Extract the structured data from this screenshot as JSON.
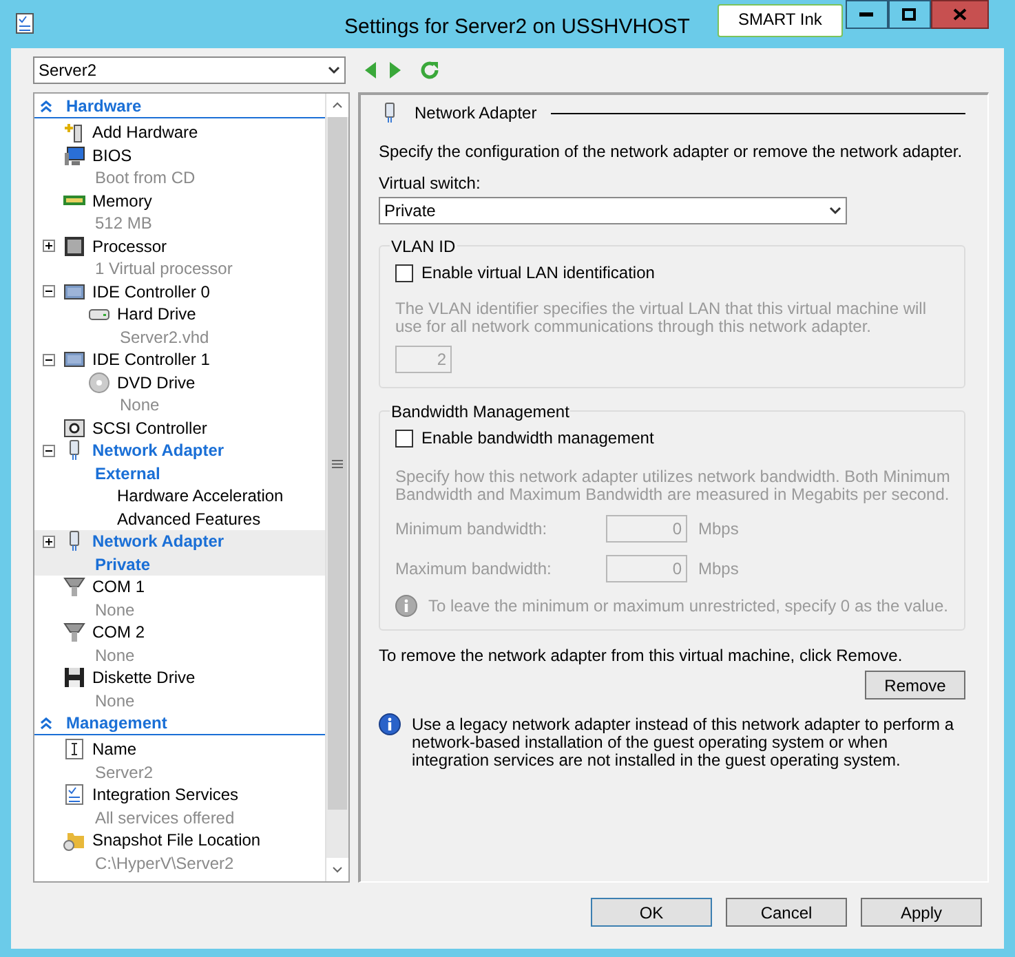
{
  "window": {
    "title": "Settings for Server2 on USSHVHOST"
  },
  "smart_ink": {
    "label": "SMART Ink"
  },
  "vm_selector": {
    "value": "Server2"
  },
  "tree": {
    "sections": [
      {
        "title": "Hardware",
        "expanded": true,
        "items": [
          {
            "label": "Add Hardware",
            "kind": "add-hardware",
            "selected": false
          },
          {
            "label": "BIOS",
            "detail": "Boot from CD",
            "kind": "bios",
            "selected": false
          },
          {
            "label": "Memory",
            "detail": "512 MB",
            "kind": "memory",
            "selected": false
          },
          {
            "label": "Processor",
            "detail": "1 Virtual processor",
            "kind": "processor",
            "expanded": false,
            "selected": false
          },
          {
            "label": "IDE Controller 0",
            "kind": "ide",
            "expanded": true,
            "selected": false,
            "children": [
              {
                "label": "Hard Drive",
                "detail": "Server2.vhd",
                "kind": "hard-drive",
                "selected": false
              }
            ]
          },
          {
            "label": "IDE Controller 1",
            "kind": "ide",
            "expanded": true,
            "selected": false,
            "children": [
              {
                "label": "DVD Drive",
                "detail": "None",
                "kind": "dvd",
                "selected": false
              }
            ]
          },
          {
            "label": "SCSI Controller",
            "kind": "scsi",
            "selected": false
          },
          {
            "label": "Network Adapter",
            "detail": "External",
            "kind": "network",
            "expanded": true,
            "selected": false,
            "children": [
              {
                "label": "Hardware Acceleration",
                "kind": "feature",
                "selected": false
              },
              {
                "label": "Advanced Features",
                "kind": "feature",
                "selected": false
              }
            ]
          },
          {
            "label": "Network Adapter",
            "detail": "Private",
            "kind": "network",
            "expanded": false,
            "selected": true
          },
          {
            "label": "COM 1",
            "detail": "None",
            "kind": "com",
            "selected": false
          },
          {
            "label": "COM 2",
            "detail": "None",
            "kind": "com",
            "selected": false
          },
          {
            "label": "Diskette Drive",
            "detail": "None",
            "kind": "diskette",
            "selected": false
          }
        ]
      },
      {
        "title": "Management",
        "expanded": true,
        "items": [
          {
            "label": "Name",
            "detail": "Server2",
            "kind": "name",
            "selected": false
          },
          {
            "label": "Integration Services",
            "detail": "All services offered",
            "kind": "integration",
            "selected": false
          },
          {
            "label": "Snapshot File Location",
            "detail": "C:\\HyperV\\Server2",
            "kind": "snapshot",
            "selected": false
          }
        ]
      }
    ]
  },
  "panel": {
    "heading": "Network Adapter",
    "intro": "Specify the configuration of the network adapter or remove the network adapter.",
    "switch_label": "Virtual switch:",
    "switch_value": "Private",
    "vlan": {
      "title": "VLAN ID",
      "checkbox": {
        "label": "Enable virtual LAN identification",
        "checked": false
      },
      "description": "The VLAN identifier specifies the virtual LAN that this virtual machine will use for all network communications through this network adapter.",
      "value": "2",
      "disabled": true
    },
    "bandwidth": {
      "title": "Bandwidth Management",
      "checkbox": {
        "label": "Enable bandwidth management",
        "checked": false
      },
      "description": "Specify how this network adapter utilizes network bandwidth. Both Minimum Bandwidth and Maximum Bandwidth are measured in Megabits per second.",
      "disabled": true,
      "fields": [
        {
          "label": "Minimum bandwidth:",
          "value": "0",
          "unit": "Mbps"
        },
        {
          "label": "Maximum bandwidth:",
          "value": "0",
          "unit": "Mbps"
        }
      ],
      "note": "To leave the minimum or maximum unrestricted, specify 0 as the value."
    },
    "remove_text": "To remove the network adapter from this virtual machine, click Remove.",
    "remove_button": "Remove",
    "info": "Use a legacy network adapter instead of this network adapter to perform a network-based installation of the guest operating system or when integration services are not installed in the guest operating system."
  },
  "buttons": [
    {
      "label": "OK",
      "default": true
    },
    {
      "label": "Cancel",
      "default": false
    },
    {
      "label": "Apply",
      "default": false
    }
  ]
}
